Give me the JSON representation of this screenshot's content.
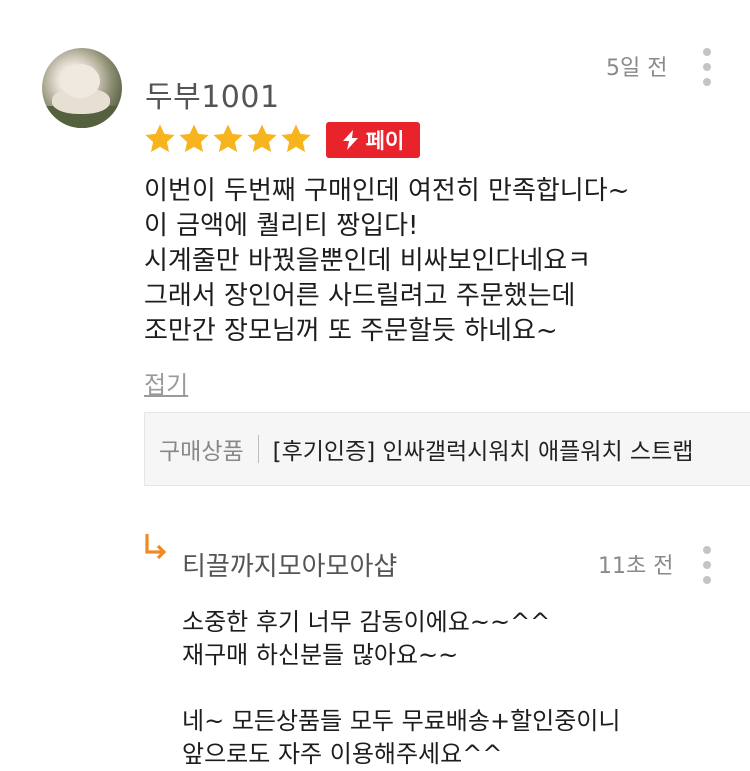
{
  "review": {
    "username": "두부1001",
    "time_ago": "5일 전",
    "rating": 5,
    "pay_badge": "페이",
    "lines": [
      "이번이 두번째 구매인데 여전히 만족합니다~",
      "이 금액에 퀄리티 짱입다!",
      "시계줄만 바꿨을뿐인데 비싸보인다네요ㅋ",
      "그래서 장인어른 사드릴려고 주문했는데",
      "조만간 장모님꺼 또 주문할듯 하네요~"
    ],
    "collapse_label": "접기",
    "product": {
      "label": "구매상품",
      "name": "[후기인증] 인싸갤럭시워치 애플워치 스트랩"
    }
  },
  "reply": {
    "seller_name": "티끌까지모아모아샵",
    "time_ago": "11초 전",
    "lines": [
      "소중한 후기 너무 감동이에요~~^^",
      "재구매 하신분들 많아요~~",
      "",
      "네~ 모든상품들 모두 무료배송+할인중이니",
      "앞으로도 자주 이용해주세요^^"
    ]
  },
  "colors": {
    "star": "#f6b51e",
    "pay_badge_bg": "#e8232b",
    "reply_arrow": "#f08a24"
  },
  "icons": {
    "more": "kebab-icon",
    "reply": "reply-arrow-icon",
    "pay": "lightning-icon"
  }
}
